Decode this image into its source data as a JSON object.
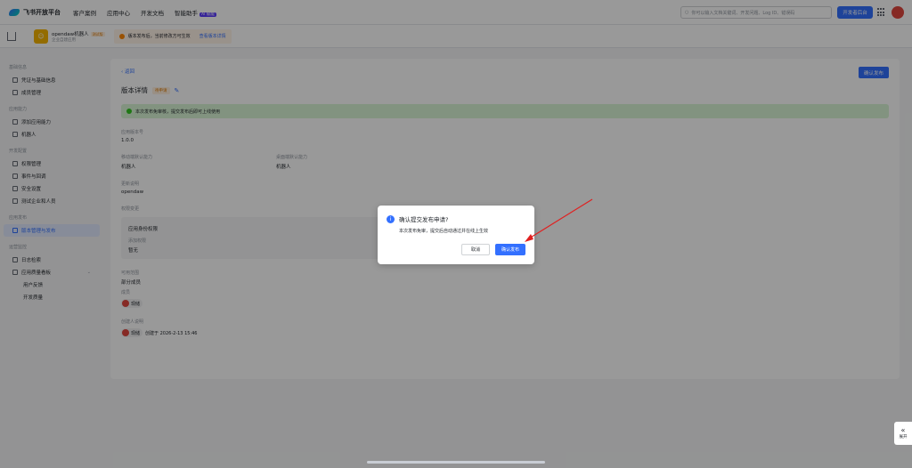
{
  "topbar": {
    "brand": "飞书开放平台",
    "nav": [
      "客户案例",
      "应用中心",
      "开发文档",
      "智能助手"
    ],
    "ai_tag": "AI 赋能",
    "search_placeholder": "你可以输入文档关键词、开发问题、Log ID、错误码",
    "dev_console": "开发者后台"
  },
  "app": {
    "name": "opendaw机器人",
    "tag": "测试版",
    "type": "企业自建应用",
    "notice": "版本发布后，当前修改方可生效",
    "notice_link": "查看版本详情"
  },
  "sidebar": {
    "sections": [
      {
        "title": "基础信息",
        "items": [
          "凭证与基础信息",
          "成员管理"
        ]
      },
      {
        "title": "应用能力",
        "items": [
          "添加应用能力",
          "机器人"
        ]
      },
      {
        "title": "开发配置",
        "items": [
          "权限管理",
          "事件与回调",
          "安全设置",
          "测试企业和人员"
        ]
      },
      {
        "title": "应用发布",
        "items": [
          "版本管理与发布"
        ]
      },
      {
        "title": "运营监控",
        "items": [
          "日志检索",
          "应用质量看板",
          "用户反馈",
          "开发质量"
        ]
      }
    ]
  },
  "main": {
    "back": "返回",
    "confirm_publish": "确认发布",
    "title": "版本详情",
    "status": "待申请",
    "success_msg": "本次发布免审核，提交发布后即可上线使用",
    "version_label": "应用版本号",
    "version_value": "1.0.0",
    "mobile_label": "移动端默认能力",
    "mobile_value": "机器人",
    "desktop_label": "桌面端默认能力",
    "desktop_value": "机器人",
    "notes_label": "更新说明",
    "notes_value": "opendaw",
    "perm_label": "权限变更",
    "perm_box": {
      "identity": "应用身份权限",
      "added_label": "添加权限",
      "added_value": "暂无"
    },
    "scope_label": "可用范围",
    "scope_value": "部分成员",
    "members_label": "成员",
    "member_name": "现储",
    "creator_label": "创建人说明",
    "creator_name": "现储",
    "created_at": "创建于 2026-2-13 15:46"
  },
  "dialog": {
    "title": "确认提交发布申请?",
    "body": "本次发布免审，提交后自动通过并在线上生效",
    "cancel": "取消",
    "confirm": "确认发布"
  },
  "expand_label": "展开",
  "colors": {
    "accent": "#3370ff",
    "warning": "#ff8800",
    "success": "#34c724",
    "arrow": "#e02020"
  }
}
